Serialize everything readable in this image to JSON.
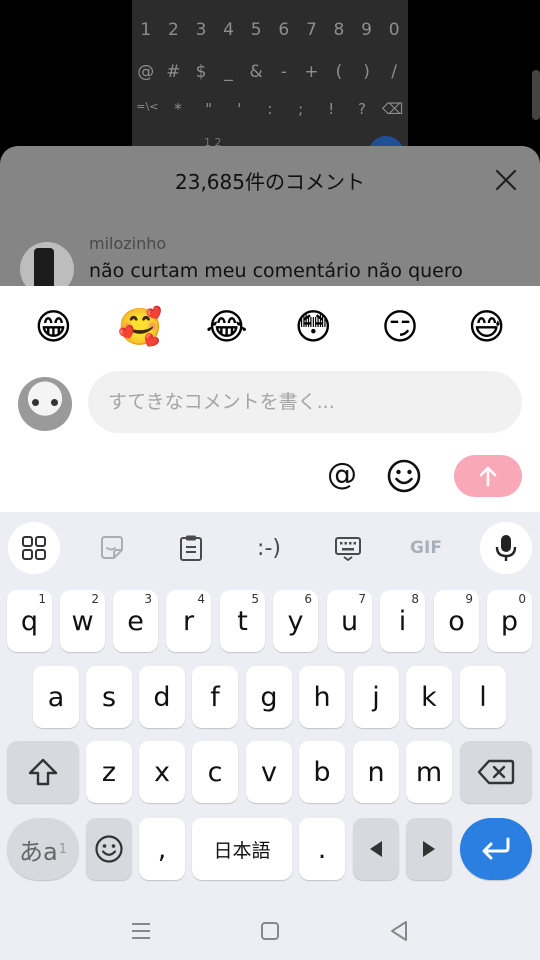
{
  "background": {
    "number_row": [
      "1",
      "2",
      "3",
      "4",
      "5",
      "6",
      "7",
      "8",
      "9",
      "0"
    ],
    "symbol_row": [
      "@",
      "#",
      "$",
      "_",
      "&",
      "-",
      "+",
      "(",
      ")",
      "/"
    ],
    "symbol_row2": [
      "=\\<",
      "*",
      "\"",
      "'",
      ":",
      ";",
      "!",
      "?",
      "⌫"
    ],
    "partial_label": "1 2"
  },
  "comments": {
    "title": "23,685件のコメント",
    "first_comment": {
      "username": "milozinho",
      "text": "não curtam meu comentário não quero"
    }
  },
  "quick_emojis": [
    "😁",
    "🥰",
    "😂",
    "😳",
    "😏",
    "😅"
  ],
  "comment_input": {
    "placeholder": "すてきなコメントを書く..."
  },
  "actions": {
    "mention_label": "@"
  },
  "colors": {
    "send_button": "#f9a8b8",
    "enter_key": "#2a7fe0",
    "keyboard_bg": "#eceef3"
  },
  "keyboard": {
    "toolbar": {
      "emoticon_label": ":-)",
      "gif_label": "GIF"
    },
    "row1": [
      {
        "label": "q",
        "hint": "1"
      },
      {
        "label": "w",
        "hint": "2"
      },
      {
        "label": "e",
        "hint": "3"
      },
      {
        "label": "r",
        "hint": "4"
      },
      {
        "label": "t",
        "hint": "5"
      },
      {
        "label": "y",
        "hint": "6"
      },
      {
        "label": "u",
        "hint": "7"
      },
      {
        "label": "i",
        "hint": "8"
      },
      {
        "label": "o",
        "hint": "9"
      },
      {
        "label": "p",
        "hint": "0"
      }
    ],
    "row2": [
      "a",
      "s",
      "d",
      "f",
      "g",
      "h",
      "j",
      "k",
      "l"
    ],
    "row3": [
      "z",
      "x",
      "c",
      "v",
      "b",
      "n",
      "m"
    ],
    "bottom": {
      "lang_toggle": "あa",
      "comma": ",",
      "space": "日本語",
      "period": "."
    }
  }
}
